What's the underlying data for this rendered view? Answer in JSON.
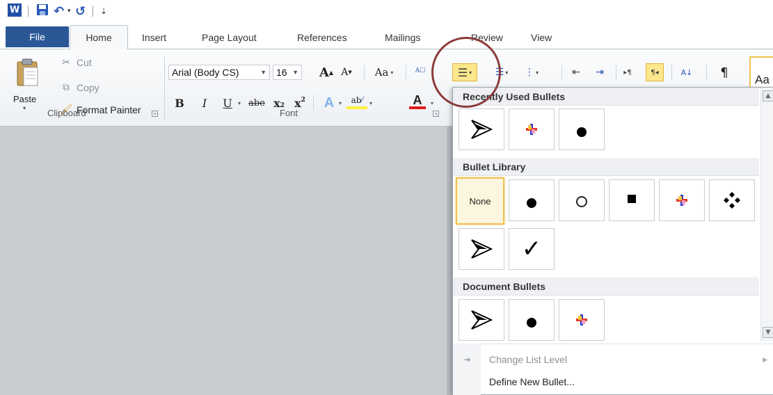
{
  "quick_access": {
    "app_icon_label": "W",
    "items": [
      "save-icon",
      "undo-icon",
      "redo-icon",
      "customize-icon"
    ]
  },
  "tabs": [
    {
      "label": "File"
    },
    {
      "label": "Home"
    },
    {
      "label": "Insert"
    },
    {
      "label": "Page Layout"
    },
    {
      "label": "References"
    },
    {
      "label": "Mailings"
    },
    {
      "label": "Review"
    },
    {
      "label": "View"
    }
  ],
  "clipboard": {
    "paste_label": "Paste",
    "cut_label": "Cut",
    "copy_label": "Copy",
    "format_painter_label": "Format Painter",
    "group_label": "Clipboard"
  },
  "font": {
    "font_name": "Arial (Body CS)",
    "font_size": "16",
    "grow_label": "A",
    "shrink_label": "A",
    "change_case_label": "Aa",
    "bold": "B",
    "italic": "I",
    "underline": "U",
    "strike": "abe",
    "subscript": "x",
    "superscript": "x",
    "highlight_label": "ab",
    "color_label": "A",
    "group_label": "Font"
  },
  "paragraph": {
    "styles_preview": "Aa"
  },
  "bullets_menu": {
    "recent_header": "Recently Used Bullets",
    "library_header": "Bullet Library",
    "none_label": "None",
    "document_header": "Document Bullets",
    "change_level_label": "Change List Level",
    "define_new_label": "Define New Bullet..."
  },
  "colors": {
    "file_tab": "#2b5797",
    "active_highlight": "#fde78c",
    "annotation_circle": "#8c3b3b",
    "document_background": "#c9cdd2"
  }
}
